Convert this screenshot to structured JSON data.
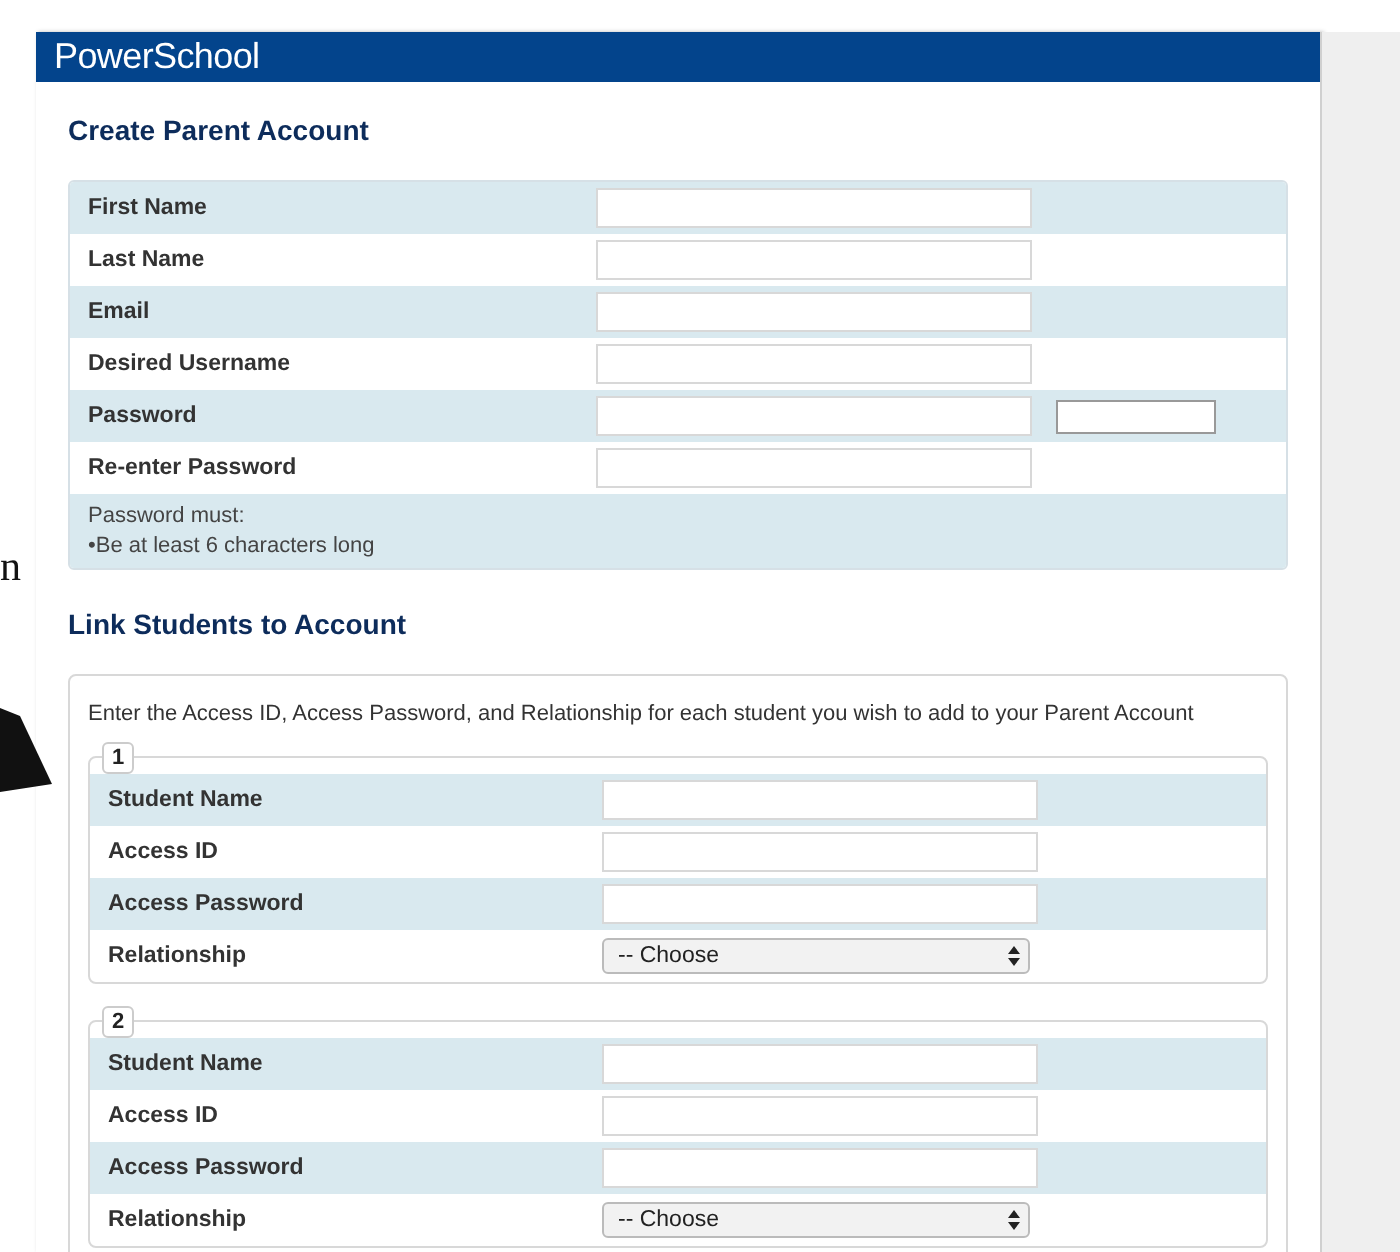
{
  "margin_text": "n",
  "header": {
    "logo": "PowerSchool"
  },
  "create_section": {
    "title": "Create Parent Account",
    "fields": [
      {
        "label": "First Name",
        "kind": "text",
        "extra_field": false
      },
      {
        "label": "Last Name",
        "kind": "text",
        "extra_field": false
      },
      {
        "label": "Email",
        "kind": "text",
        "extra_field": false
      },
      {
        "label": "Desired Username",
        "kind": "text",
        "extra_field": false
      },
      {
        "label": "Password",
        "kind": "text",
        "extra_field": true
      },
      {
        "label": "Re-enter Password",
        "kind": "text",
        "extra_field": false
      }
    ],
    "hint_lines": [
      "Password must:",
      "•Be at least 6 characters long"
    ]
  },
  "link_section": {
    "title": "Link Students to Account",
    "intro": "Enter the Access ID, Access Password, and Relationship for each student you wish to add to your Parent Account",
    "students": [
      {
        "number": "1",
        "fields": [
          {
            "label": "Student Name",
            "kind": "text"
          },
          {
            "label": "Access ID",
            "kind": "text"
          },
          {
            "label": "Access Password",
            "kind": "text"
          },
          {
            "label": "Relationship",
            "kind": "select",
            "value": "-- Choose"
          }
        ]
      },
      {
        "number": "2",
        "fields": [
          {
            "label": "Student Name",
            "kind": "text"
          },
          {
            "label": "Access ID",
            "kind": "text"
          },
          {
            "label": "Access Password",
            "kind": "text"
          },
          {
            "label": "Relationship",
            "kind": "select",
            "value": "-- Choose"
          }
        ]
      }
    ]
  }
}
